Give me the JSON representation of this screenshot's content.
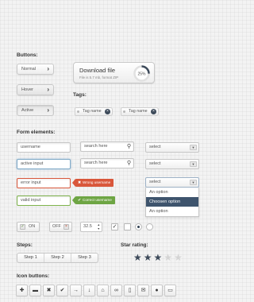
{
  "sections": {
    "buttons": "Buttons:",
    "tags": "Tags:",
    "form": "Form elements:",
    "steps": "Steps:",
    "rating": "Star rating:",
    "icons": "Icon buttons:"
  },
  "buttons": [
    {
      "label": "Normal",
      "icon": "chevron-right-icon"
    },
    {
      "label": "Hover",
      "icon": "chevron-right-icon"
    },
    {
      "label": "Active",
      "icon": "chevron-right-icon"
    }
  ],
  "download": {
    "title": "Download file",
    "subtitle": "File is 5.7 mb, format ZIP",
    "progress_label": "25%",
    "progress": 0.25
  },
  "tags": [
    {
      "label": "Tag name",
      "close": "×"
    },
    {
      "label": "Tag name",
      "close": "×"
    }
  ],
  "form": {
    "username_value": "username",
    "active_value": "active input",
    "error_value": "error input",
    "valid_value": "valid input",
    "search1": "search here",
    "search2": "search here",
    "select1": "select",
    "select2": "select",
    "select3": "select",
    "error_msg": "Wrong username",
    "valid_msg": "Correct username",
    "dropdown_options": [
      "An option",
      "Choosen option",
      "An option"
    ],
    "toggle_on": "ON",
    "toggle_off": "OFF",
    "stepper_value": "32.5"
  },
  "steps": [
    "Step 1",
    "Step 2",
    "Step 3"
  ],
  "rating": {
    "value": 3,
    "max": 5
  },
  "icon_buttons": [
    "plus-icon",
    "minus-icon",
    "close-icon",
    "check-icon",
    "arrow-right-icon",
    "arrow-down-icon",
    "home-icon",
    "link-icon",
    "phone-icon",
    "mail-icon",
    "user-icon",
    "monitor-icon"
  ],
  "colors": {
    "error": "#d9573b",
    "success": "#6ea544",
    "dark": "#3d4a5a",
    "highlight": "#3e546d"
  }
}
